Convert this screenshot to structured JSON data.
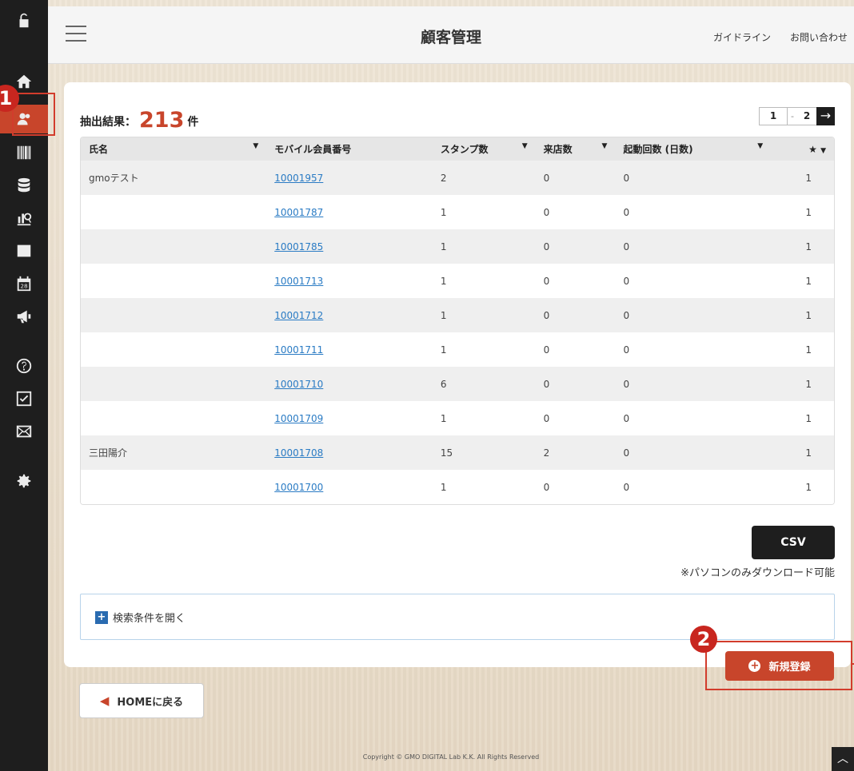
{
  "header": {
    "title": "顧客管理",
    "links": [
      "ガイドライン",
      "お問い合わせ"
    ]
  },
  "sidebar": {
    "icons": [
      "lock-icon",
      "home-icon",
      "customer-icon",
      "barcode-icon",
      "database-icon",
      "stats-icon",
      "notice-icon",
      "calendar-icon",
      "megaphone-icon",
      "help-icon",
      "checkbox-icon",
      "mail-icon",
      "gear-icon"
    ],
    "calendar_day": "28"
  },
  "annotations": {
    "badge1": "1",
    "badge2": "2"
  },
  "results": {
    "label": "抽出結果：",
    "count": "213",
    "unit": "件"
  },
  "pager": {
    "page1": "1",
    "page2": "2",
    "sep": "-"
  },
  "table": {
    "headers": [
      "氏名",
      "モバイル会員番号",
      "スタンプ数",
      "来店数",
      "起動回数 (日数)",
      "★"
    ],
    "rows": [
      {
        "name": "gmoテスト",
        "member_id": "10001957",
        "stamps": "2",
        "visits": "0",
        "launches": "0",
        "star": "1"
      },
      {
        "name": "",
        "member_id": "10001787",
        "stamps": "1",
        "visits": "0",
        "launches": "0",
        "star": "1"
      },
      {
        "name": "",
        "member_id": "10001785",
        "stamps": "1",
        "visits": "0",
        "launches": "0",
        "star": "1"
      },
      {
        "name": "",
        "member_id": "10001713",
        "stamps": "1",
        "visits": "0",
        "launches": "0",
        "star": "1"
      },
      {
        "name": "",
        "member_id": "10001712",
        "stamps": "1",
        "visits": "0",
        "launches": "0",
        "star": "1"
      },
      {
        "name": "",
        "member_id": "10001711",
        "stamps": "1",
        "visits": "0",
        "launches": "0",
        "star": "1"
      },
      {
        "name": "",
        "member_id": "10001710",
        "stamps": "6",
        "visits": "0",
        "launches": "0",
        "star": "1"
      },
      {
        "name": "",
        "member_id": "10001709",
        "stamps": "1",
        "visits": "0",
        "launches": "0",
        "star": "1"
      },
      {
        "name": "三田陽介",
        "member_id": "10001708",
        "stamps": "15",
        "visits": "2",
        "launches": "0",
        "star": "1"
      },
      {
        "name": "",
        "member_id": "10001700",
        "stamps": "1",
        "visits": "0",
        "launches": "0",
        "star": "1"
      }
    ]
  },
  "csv": {
    "label": "CSV",
    "note": "※パソコンのみダウンロード可能"
  },
  "search": {
    "toggle_label": "検索条件を開く"
  },
  "new_registration": {
    "label": "新規登録"
  },
  "home_button": {
    "label": "HOMEに戻る"
  },
  "footer": {
    "copyright": "Copyright © GMO DIGITAL Lab K.K. All Rights Reserved"
  },
  "colors": {
    "accent": "#c8452b",
    "sidebar": "#1e1e1e",
    "link": "#2a7bc4"
  }
}
